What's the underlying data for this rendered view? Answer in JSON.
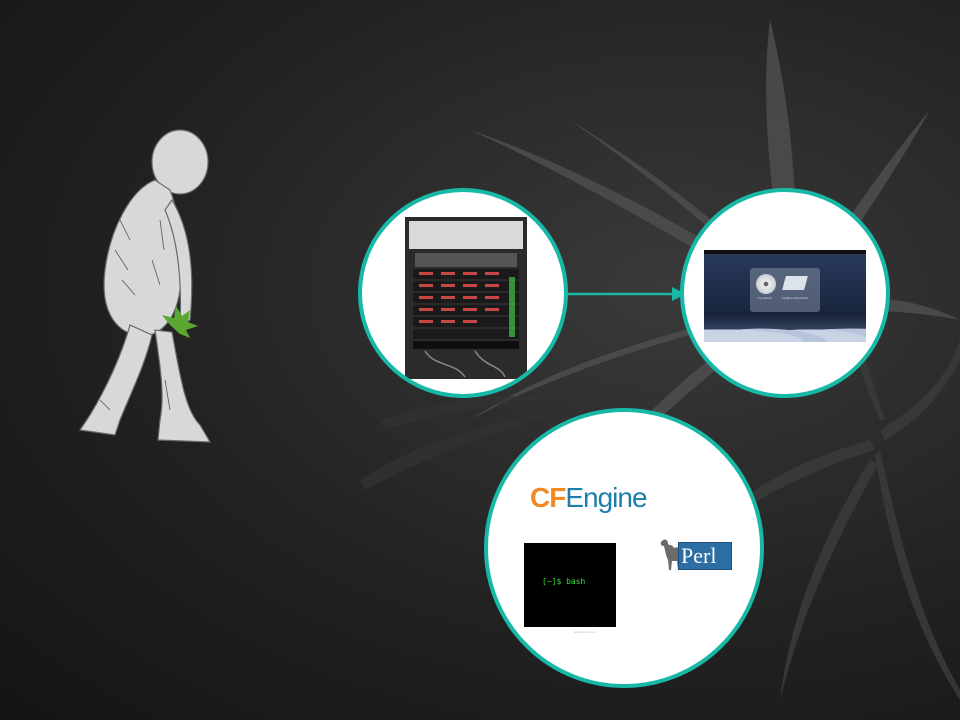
{
  "colors": {
    "accent_ring": "#17b8a6",
    "background": "#1c1c1c",
    "leaf": "#5a5a5a",
    "cfengine_orange": "#f08a24",
    "cfengine_blue": "#1a7faa",
    "terminal_text": "#3ddc3d",
    "perl_blue": "#2c6da3"
  },
  "icons": {
    "background": "cannabis-leaf-icon",
    "evolution": "ape-man-walking-icon",
    "server": "server-rack-icon",
    "installer": "os-installer-icon",
    "perl": "camel-icon"
  },
  "installer": {
    "option_1": "Try Fedora",
    "option_2": "Install to Hard Drive"
  },
  "tools": {
    "cfengine_cf": "CF",
    "cfengine_engine": "Engine",
    "terminal_prompt": "[~]$ bash",
    "terminal_caption": "shutterstock.com",
    "perl_label": "Perl"
  }
}
